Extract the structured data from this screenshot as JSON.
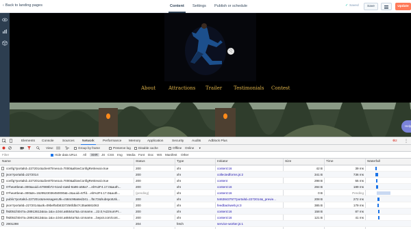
{
  "topbar": {
    "back_label": "Back to landing pages",
    "tabs": [
      "Content",
      "Settings",
      "Publish or schedule"
    ],
    "saved_label": "Saved",
    "save_label": "Save",
    "update_label": "Update"
  },
  "canvas": {
    "nav": [
      "About",
      "Attractions",
      "Trailer",
      "Testimonials",
      "Contest"
    ],
    "help_label": "Help"
  },
  "devtools": {
    "tabs": [
      "Elements",
      "Console",
      "Sources",
      "Network",
      "Performance",
      "Memory",
      "Application",
      "Security",
      "Audits",
      "Adblock Plus"
    ],
    "active_tab": "Network",
    "error_count": "2",
    "toolbar": {
      "view_label": "View:",
      "group_by_frame": "Group by frame",
      "preserve_log": "Preserve log",
      "disable_cache": "Disable cache",
      "offline": "Offline",
      "throttle": "Online"
    },
    "filter": {
      "placeholder": "Filter",
      "hide_data_urls": "Hide data URLs",
      "types": [
        "All",
        "XHR",
        "JS",
        "CSS",
        "Img",
        "Media",
        "Font",
        "Doc",
        "WS",
        "Manifest",
        "Other"
      ],
      "selected_type": "XHR"
    },
    "columns": [
      "Name",
      "Status",
      "Type",
      "Initiator",
      "Size",
      "Time",
      "Waterfall"
    ],
    "rows": [
      {
        "name": "config?portalId=2272014&clientTimeout=7000&allowConfigRetrieval=true",
        "status": "200",
        "type": "xhr",
        "initiator": "content:16",
        "size": "42 B",
        "time": "39 ms"
      },
      {
        "name": "json?portalId=2272014",
        "status": "200",
        "type": "xhr",
        "initiator": "collectedforms.js:2",
        "size": "341 B",
        "time": "736 ms"
      },
      {
        "name": "config?portalId=2272014&clientTimeout=7000&allowConfigRetrieval=true",
        "status": "200",
        "type": "xhr",
        "initiator": "content",
        "size": "298 B",
        "time": "55 ms"
      },
      {
        "name": "0?heartbeat=300&uuid=67869b72-51ed-4a8d-9a96-a58a7....eb%2F4.17.0&auth...",
        "status": "200",
        "type": "xhr",
        "initiator": "content:16",
        "size": "284 B",
        "time": "189 ms"
      },
      {
        "name": "0?heartbeat=300&ts=1529523036450000&t=2&uuid=67fd....eb%2F4.17.0&auth...",
        "status": "(pending)",
        "type": "xhr",
        "initiator": "content:16",
        "size": "0 B",
        "time": "Pending"
      },
      {
        "name": "public?portalId=2272014&messagesUtk=c584c98a8ed241....f5c72&hubspotUtk...",
        "status": "200",
        "type": "xhr",
        "initiator": "54638437577portalId=2272014&_previe...",
        "size": "208 B",
        "time": "272 ms"
      },
      {
        "name": "json?portalId=2272014&utk=09bef54b8337256fdb47c35a6681063",
        "status": "200",
        "type": "xhr",
        "initiator": "feedbackweb.js:3",
        "size": "385 B",
        "time": "179 ms"
      },
      {
        "name": "f9d051f4047a=28913612&sa=1&v=1044.a6554a7&t=Unname....22.0,%22numPr...",
        "status": "200",
        "type": "xhr",
        "initiator": "content:16",
        "size": "158 B",
        "time": "87 ms"
      },
      {
        "name": "f9d051f4047a=28913612&sa=1&v=1044.a6554a7&t=Unname....bepot.com/cont...",
        "status": "200",
        "type": "xhr",
        "initiator": "content:16",
        "size": "121 B",
        "time": "41 ms"
      },
      {
        "name": "2901298",
        "status": "204",
        "type": "fetch",
        "initiator": "service-worker.js:1",
        "size": "",
        "time": ""
      }
    ]
  },
  "colors": {
    "accent": "#ff7a59",
    "rail": "#2d3e50",
    "nav_text": "#e0b44a",
    "devtools_blue": "#1a73e8"
  }
}
